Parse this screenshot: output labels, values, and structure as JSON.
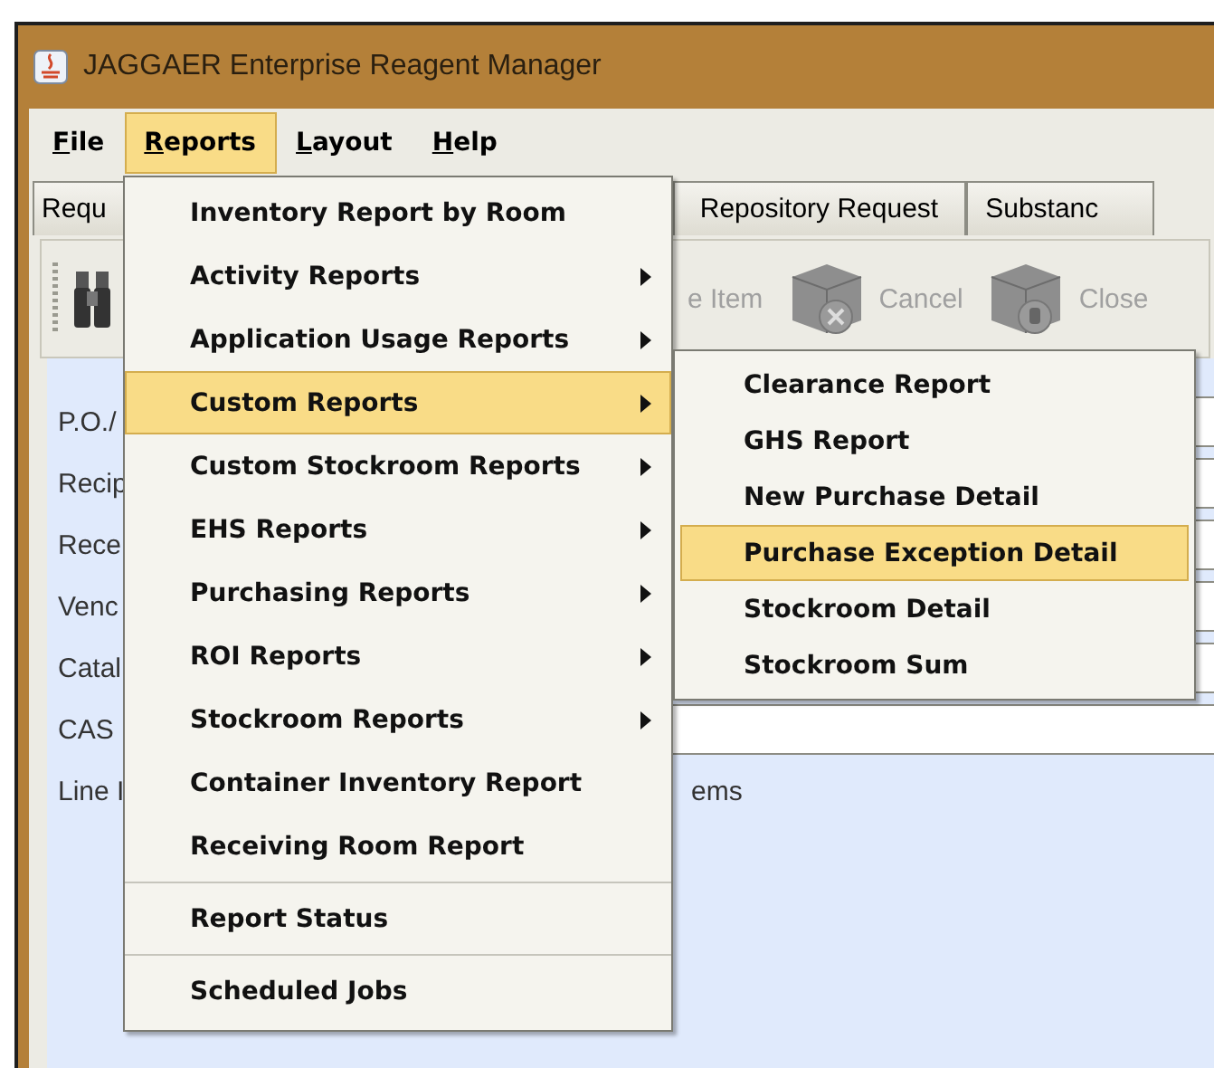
{
  "window": {
    "title": "JAGGAER Enterprise Reagent Manager"
  },
  "menubar": [
    {
      "label": "File",
      "selected": false
    },
    {
      "label": "Reports",
      "selected": true
    },
    {
      "label": "Layout",
      "selected": false
    },
    {
      "label": "Help",
      "selected": false
    }
  ],
  "tabs": [
    {
      "label": "Requ"
    },
    {
      "label": "Repository Request"
    },
    {
      "label": "Substanc"
    }
  ],
  "toolbar": [
    {
      "kind": "find"
    },
    {
      "kind": "text",
      "label": "e Item",
      "disabled": true
    },
    {
      "kind": "cancel",
      "label": "Cancel",
      "disabled": true
    },
    {
      "kind": "close",
      "label": "Close",
      "disabled": true
    }
  ],
  "form": [
    {
      "label": "P.O./"
    },
    {
      "label": "Recip"
    },
    {
      "label": "Rece"
    },
    {
      "label": "Venc"
    },
    {
      "label": "Catal"
    },
    {
      "label": "CAS"
    },
    {
      "label": "Line I",
      "value": "ems"
    }
  ],
  "menu": [
    {
      "kind": "item",
      "label": "Inventory Report by Room",
      "selected": false
    },
    {
      "kind": "submenu",
      "label": "Activity Reports",
      "selected": false
    },
    {
      "kind": "submenu",
      "label": "Application Usage Reports",
      "selected": false
    },
    {
      "kind": "submenu",
      "label": "Custom Reports",
      "selected": true
    },
    {
      "kind": "submenu",
      "label": "Custom Stockroom Reports",
      "selected": false
    },
    {
      "kind": "submenu",
      "label": "EHS Reports",
      "selected": false
    },
    {
      "kind": "submenu",
      "label": "Purchasing Reports",
      "selected": false
    },
    {
      "kind": "submenu",
      "label": "ROI Reports",
      "selected": false
    },
    {
      "kind": "submenu",
      "label": "Stockroom Reports",
      "selected": false
    },
    {
      "kind": "item",
      "label": "Container Inventory Report",
      "selected": false
    },
    {
      "kind": "item",
      "label": "Receiving Room Report",
      "selected": false
    },
    {
      "kind": "separator"
    },
    {
      "kind": "item",
      "label": "Report Status",
      "selected": false
    },
    {
      "kind": "separator"
    },
    {
      "kind": "item",
      "label": "Scheduled Jobs",
      "selected": false
    }
  ],
  "submenu": [
    {
      "label": "Clearance Report",
      "selected": false
    },
    {
      "label": "GHS Report",
      "selected": false
    },
    {
      "label": "New Purchase Detail",
      "selected": false
    },
    {
      "label": "Purchase Exception Detail",
      "selected": true
    },
    {
      "label": "Stockroom Detail",
      "selected": false
    },
    {
      "label": "Stockroom Sum",
      "selected": false
    }
  ]
}
